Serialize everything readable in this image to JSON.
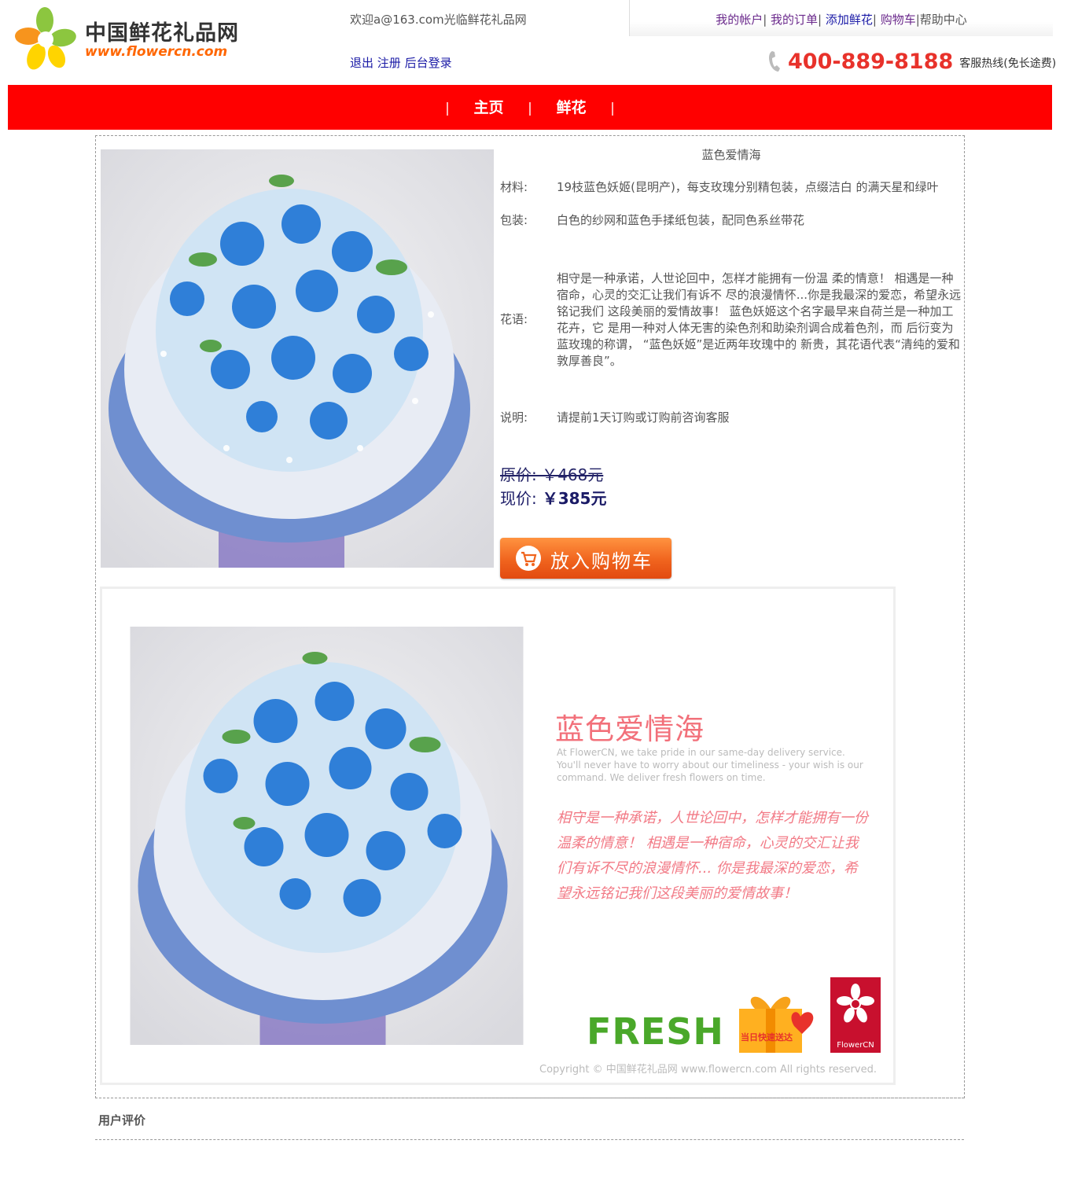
{
  "header": {
    "logo_cn": "中国鲜花礼品网",
    "logo_en": "www.flowercn.com",
    "welcome": "欢迎a@163.com光临鲜花礼品网",
    "auth_links": [
      "退出",
      "注册",
      "后台登录"
    ],
    "top_nav": [
      "我的帐户",
      "我的订单",
      "添加鲜花",
      "购物车",
      "帮助中心"
    ],
    "hotline_number": "400-889-8188",
    "hotline_text": "客服热线(免长途费)"
  },
  "main_nav": {
    "separator": "|",
    "items": [
      "主页",
      "鲜花"
    ]
  },
  "product": {
    "name": "蓝色爱情海",
    "material_label": "材料:",
    "material": "19枝蓝色妖姬(昆明产)，每支玫瑰分别精包装，点缀洁白 的满天星和绿叶",
    "packaging_label": "包装:",
    "packaging": "白色的纱网和蓝色手揉纸包装，配同色系丝带花",
    "meaning_label": "花语:",
    "meaning": "相守是一种承诺，人世论回中，怎样才能拥有一份温 柔的情意！ 相遇是一种宿命，心灵的交汇让我们有诉不 尽的浪漫情怀...你是我最深的爱恋，希望永远铭记我们 这段美丽的爱情故事！ 蓝色妖姬这个名字最早来自荷兰是一种加工花卉，它 是用一种对人体无害的染色剂和助染剂调合成着色剂，而 后衍变为蓝玫瑰的称谓， “蓝色妖姬”是近两年玫瑰中的 新贵，其花语代表“清纯的爱和敦厚善良”。",
    "note_label": "说明:",
    "note": "请提前1天订购或订购前咨询客服",
    "original_price": "原价: ￥468元",
    "current_price_label": "现价:",
    "current_price": "￥385元",
    "cart_button": "放入购物车"
  },
  "banner": {
    "title": "蓝色爱情海",
    "english": "At FlowerCN, we take pride in our same-day delivery service. You'll never have to worry about our timeliness - your wish is our command. We deliver fresh flowers on time.",
    "poem": "相守是一种承诺，人世论回中，怎样才能拥有一份温柔的情意！ 相遇是一种宿命，心灵的交汇让我们有诉不尽的浪漫情怀... 你是我最深的爱恋，希望永远铭记我们这段美丽的爱情故事！",
    "fresh": "FRESH",
    "gift_text": "当日快速送达",
    "badge_text": "FlowerCN",
    "copyright": "Copyright © 中国鲜花礼品网 www.flowercn.com All rights reserved."
  },
  "review": {
    "title": "用户评价"
  },
  "colors": {
    "nav_red": "#ff0000",
    "link_blue": "#1a1aa6",
    "link_purple": "#6b2a8c",
    "hotline_red": "#e8322b",
    "cart_orange": "#f0641e"
  }
}
